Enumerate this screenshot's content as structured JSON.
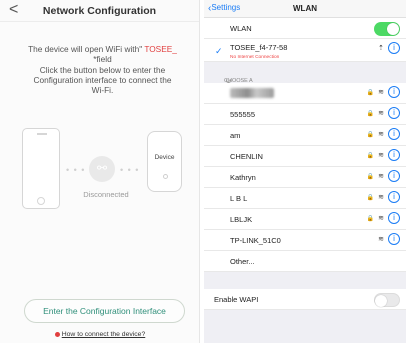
{
  "left": {
    "back": "<",
    "title": "Network Configuration",
    "desc_line1_a": "The device will open WiFi with\"",
    "desc_line1_b": "TOSEE_",
    "desc_line2": "*field",
    "desc_line3": "Click the button below to enter the",
    "desc_line4": "Configuration interface to connect the",
    "desc_line5": "Wi-Fi.",
    "status": "Disconnected",
    "device_label": "Device",
    "config_button": "Enter the Configuration Interface",
    "help_link": "How to connect the device?"
  },
  "right": {
    "back": "Settings",
    "title": "WLAN",
    "wlan_label": "WLAN",
    "wlan_on": true,
    "connected": {
      "name": "TOSEE_f4-77-58",
      "warning": "No Internet Connection"
    },
    "section_header": "CHOOSE A NETWORK...",
    "networks": [
      {
        "name": "",
        "lock": true
      },
      {
        "name": "555555",
        "lock": true
      },
      {
        "name": "am",
        "lock": true
      },
      {
        "name": "CHENLIN",
        "lock": true
      },
      {
        "name": "Kathryn",
        "lock": true
      },
      {
        "name": "L B L",
        "lock": true
      },
      {
        "name": "LBLJK",
        "lock": true
      },
      {
        "name": "TP-LINK_51C0",
        "lock": false
      }
    ],
    "other": "Other...",
    "wapi_label": "Enable WAPI",
    "wapi_on": false
  },
  "colors": {
    "accent_blue": "#1a7cf5",
    "toggle_green": "#4cd964",
    "red": "#e13f3f",
    "teal": "#2f8f7a"
  }
}
